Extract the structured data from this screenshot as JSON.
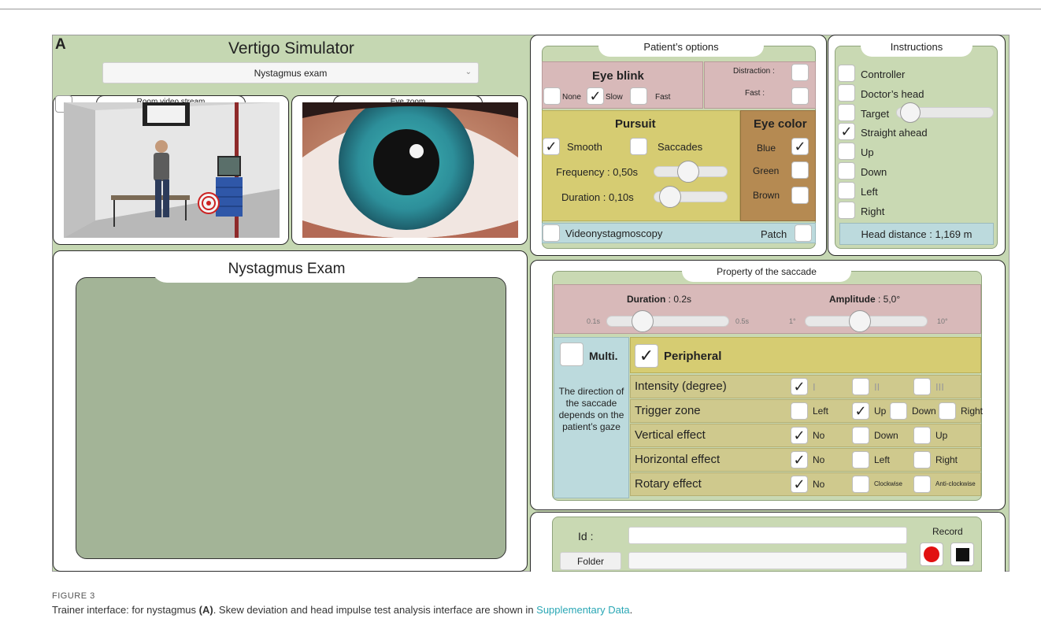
{
  "figure_label": "A",
  "app_title": "Vertigo Simulator",
  "exam_select": {
    "value": "Nystagmus exam"
  },
  "room_video": {
    "label": "Room video stream"
  },
  "eye_zoom": {
    "label": "Eye zoom"
  },
  "nystagmus_panel": {
    "title": "Nystagmus Exam"
  },
  "patient_options": {
    "title": "Patient’s options",
    "eye_blink": {
      "title": "Eye blink",
      "options": [
        {
          "label": "None",
          "checked": false
        },
        {
          "label": "Slow",
          "checked": true
        },
        {
          "label": "Fast",
          "checked": false
        }
      ],
      "distraction_label": "Distraction :",
      "fast_label": "Fast :"
    },
    "pursuit": {
      "title": "Pursuit",
      "smooth_label": "Smooth",
      "smooth_checked": true,
      "saccades_label": "Saccades",
      "saccades_checked": false,
      "frequency_label": "Frequency : 0,50s",
      "duration_label": "Duration : 0,10s",
      "frequency_slider_value": 0.45,
      "duration_slider_value": 0.1
    },
    "eye_color": {
      "title": "Eye color",
      "options": [
        {
          "label": "Blue",
          "checked": true
        },
        {
          "label": "Green",
          "checked": false
        },
        {
          "label": "Brown",
          "checked": false
        }
      ]
    },
    "videonystagmoscopy_label": "Videonystagmoscopy",
    "patch_label": "Patch"
  },
  "instructions": {
    "title": "Instructions",
    "items": [
      {
        "label": "Controller",
        "checked": false
      },
      {
        "label": "Doctor’s head",
        "checked": false
      },
      {
        "label": "Target",
        "checked": false
      },
      {
        "label": "Straight ahead",
        "checked": true
      },
      {
        "label": "Up",
        "checked": false
      },
      {
        "label": "Down",
        "checked": false
      },
      {
        "label": "Left",
        "checked": false
      },
      {
        "label": "Right",
        "checked": false
      }
    ],
    "target_slider_value": 0.05,
    "head_distance": "Head distance  :  1,169 m"
  },
  "saccade": {
    "title": "Property of the saccade",
    "duration_label": "Duration",
    "duration_value": " : 0.2s",
    "duration_min": "0.1s",
    "duration_max": "0.5s",
    "duration_slider_value": 0.25,
    "amplitude_label": "Amplitude",
    "amplitude_value": " : 5,0°",
    "amplitude_min": "1°",
    "amplitude_max": "10°",
    "amplitude_slider_value": 0.44,
    "multi_label": "Multi.",
    "multi_checked": false,
    "multi_description": "The direction of the saccade depends on the patient’s gaze",
    "peripheral_label": "Peripheral",
    "peripheral_checked": true,
    "rows": [
      {
        "label": "Intensity (degree)",
        "options": [
          {
            "label": "I",
            "checked": true
          },
          {
            "label": "II",
            "checked": false
          },
          {
            "label": "III",
            "checked": false
          }
        ]
      },
      {
        "label": "Trigger zone",
        "options": [
          {
            "label": "Left",
            "checked": false
          },
          {
            "label": "Up",
            "checked": true
          },
          {
            "label": "Down",
            "checked": false
          },
          {
            "label": "Right",
            "checked": false
          }
        ]
      },
      {
        "label": "Vertical effect",
        "options": [
          {
            "label": "No",
            "checked": true
          },
          {
            "label": "Down",
            "checked": false
          },
          {
            "label": "Up",
            "checked": false
          }
        ]
      },
      {
        "label": "Horizontal effect",
        "options": [
          {
            "label": "No",
            "checked": true
          },
          {
            "label": "Left",
            "checked": false
          },
          {
            "label": "Right",
            "checked": false
          }
        ]
      },
      {
        "label": "Rotary effect",
        "options": [
          {
            "label": "No",
            "checked": true
          },
          {
            "label": "Clockwise",
            "checked": false
          },
          {
            "label": "Anti-clockwise",
            "checked": false
          }
        ]
      }
    ]
  },
  "record": {
    "id_label": "Id :",
    "id_value": "",
    "folder_button": "Folder",
    "folder_value": "",
    "record_label": "Record"
  },
  "caption": {
    "figure_number": "FIGURE 3",
    "text_before": "Trainer interface: for nystagmus ",
    "text_bold": "(A)",
    "text_middle": ". Skew deviation and head impulse test analysis interface are shown in ",
    "link_text": "Supplementary Data",
    "text_after": "."
  },
  "colors": {
    "background_green": "#c5d7b2",
    "eye_blink": "#d8b9b9",
    "pursuit": "#d6cc72",
    "eye_color": "#b58a52",
    "videonystagmoscopy": "#bcdadd",
    "exam_area": "#a3b497",
    "record_button": "#e11010",
    "caption_link": "#2aa7b5"
  }
}
